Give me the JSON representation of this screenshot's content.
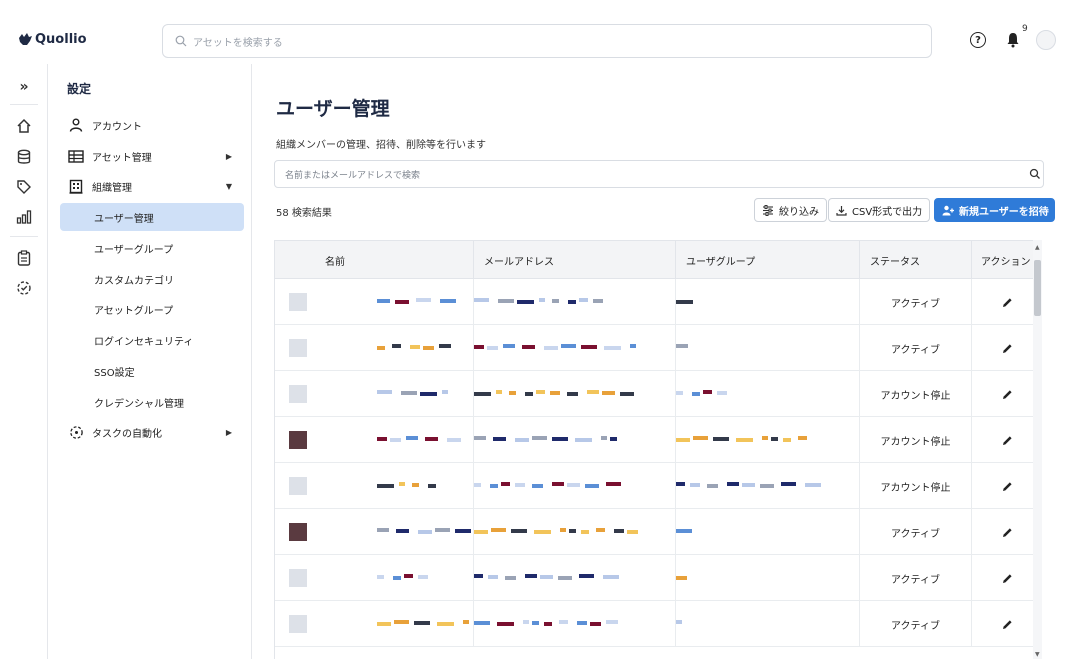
{
  "app": {
    "name": "Quollio"
  },
  "header": {
    "search_placeholder": "アセットを検索する",
    "notification_count": "9"
  },
  "rail": {
    "icons": [
      "collapse-icon",
      "home-icon",
      "database-icon",
      "tag-icon",
      "chart-icon",
      "clipboard-icon",
      "automation-icon"
    ]
  },
  "sidebar": {
    "title": "設定",
    "items": [
      {
        "label": "アカウント",
        "icon": "user-icon"
      },
      {
        "label": "アセット管理",
        "icon": "table-icon",
        "expand": "▶"
      },
      {
        "label": "組織管理",
        "icon": "building-icon",
        "expand": "▼"
      }
    ],
    "org_sub": [
      {
        "label": "ユーザー管理",
        "active": true
      },
      {
        "label": "ユーザーグループ"
      },
      {
        "label": "カスタムカテゴリ"
      },
      {
        "label": "アセットグループ"
      },
      {
        "label": "ログインセキュリティ"
      },
      {
        "label": "SSO設定"
      },
      {
        "label": "クレデンシャル管理"
      }
    ],
    "automation": {
      "label": "タスクの自動化",
      "icon": "automation-icon",
      "expand": "▶"
    }
  },
  "main": {
    "title": "ユーザー管理",
    "description": "組織メンバーの管理、招待、削除等を行います",
    "search_placeholder": "名前またはメールアドレスで検索",
    "result_count": "58 検索結果",
    "filter_button": "絞り込み",
    "csv_button": "CSV形式で出力",
    "invite_button": "新規ユーザーを招待",
    "accent_color": "#2f7bd8"
  },
  "table": {
    "columns": [
      "名前",
      "メールアドレス",
      "ユーザグループ",
      "ステータス",
      "アクション"
    ],
    "rows": [
      {
        "status": "アクティブ"
      },
      {
        "status": "アクティブ"
      },
      {
        "status": "アカウント停止"
      },
      {
        "status": "アカウント停止"
      },
      {
        "status": "アカウント停止"
      },
      {
        "status": "アクティブ"
      },
      {
        "status": "アクティブ"
      },
      {
        "status": "アクティブ"
      }
    ]
  }
}
